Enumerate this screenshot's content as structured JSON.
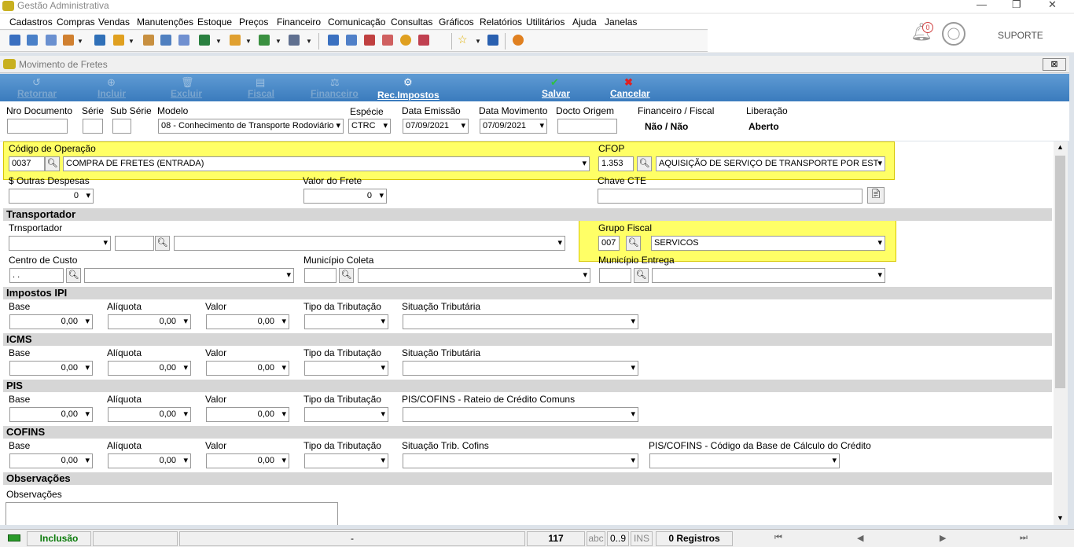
{
  "app": {
    "title": "Gestão Administrativa"
  },
  "menu": [
    "Cadastros",
    "Compras",
    "Vendas",
    "Manutenções",
    "Estoque",
    "Preços",
    "Financeiro",
    "Comunicação",
    "Consultas",
    "Gráficos",
    "Relatórios",
    "Utilitários",
    "Ajuda",
    "Janelas"
  ],
  "topright": {
    "notif_count": "0",
    "user": "SUPORTE"
  },
  "form": {
    "title": "Movimento de Fretes",
    "close": "⊠"
  },
  "actions": {
    "retornar": "Retornar",
    "incluir": "Incluir",
    "excluir": "Excluir",
    "fiscal": "Fiscal",
    "financeiro": "Financeiro",
    "rec_impostos": "Rec.Impostos",
    "salvar": "Salvar",
    "cancelar": "Cancelar"
  },
  "header": {
    "nro_documento": "Nro Documento",
    "serie": "Série",
    "sub_serie": "Sub Série",
    "modelo": "Modelo",
    "modelo_value": "08 - Conhecimento de Transporte Rodoviário",
    "especie": "Espécie",
    "especie_value": "CTRC",
    "data_emissao": "Data Emissão",
    "data_emissao_value": "07/09/2021",
    "data_movimento": "Data Movimento",
    "data_movimento_value": "07/09/2021",
    "docto_origem": "Docto Origem",
    "fin_fiscal": "Financeiro / Fiscal",
    "fin_fiscal_value": "Não / Não",
    "liberacao": "Liberação",
    "liberacao_value": "Aberto"
  },
  "operacao": {
    "label": "Código de Operação",
    "code": "0037",
    "desc": "COMPRA DE FRETES (ENTRADA)"
  },
  "cfop": {
    "label": "CFOP",
    "code": "1.353",
    "desc": "AQUISIÇÃO DE SERVIÇO DE TRANSPORTE POR EST"
  },
  "outras": {
    "label": "$ Outras Despesas",
    "value": "0"
  },
  "valor_frete": {
    "label": "Valor do Frete",
    "value": "0"
  },
  "chave_cte": {
    "label": "Chave CTE"
  },
  "transportador": {
    "section": "Transportador",
    "label": "Trnsportador",
    "grupo_fiscal": "Grupo Fiscal",
    "grupo_code": "007",
    "grupo_desc": "SERVICOS",
    "centro_custo": "Centro de Custo",
    "centro_value": " .  .",
    "municipio_coleta": "Município Coleta",
    "municipio_entrega": "Município Entrega"
  },
  "ipi": {
    "section": "Impostos IPI",
    "base": "Base",
    "aliquota": "Alíquota",
    "valor": "Valor",
    "tipo": "Tipo da Tributação",
    "situacao": "Situação Tributária",
    "v": "0,00"
  },
  "icms": {
    "section": "ICMS",
    "base": "Base",
    "aliquota": "Alíquota",
    "valor": "Valor",
    "tipo": "Tipo da Tributação",
    "situacao": "Situação Tributária",
    "v": "0,00"
  },
  "pis": {
    "section": "PIS",
    "base": "Base",
    "aliquota": "Alíquota",
    "valor": "Valor",
    "tipo": "Tipo da Tributação",
    "rateio": "PIS/COFINS - Rateio de Crédito Comuns",
    "v": "0,00"
  },
  "cofins": {
    "section": "COFINS",
    "base": "Base",
    "aliquota": "Alíquota",
    "valor": "Valor",
    "tipo": "Tipo da Tributação",
    "situacao": "Situação Trib. Cofins",
    "codigo_base": "PIS/COFINS - Código da Base de Cálculo do Crédito",
    "v": "0,00"
  },
  "obs": {
    "section": "Observações",
    "label": "Observações"
  },
  "status": {
    "mode": "Inclusão",
    "dash": "-",
    "count": "117",
    "abc": "abc",
    "range": "0..9",
    "ins": "INS",
    "registros": "0 Registros"
  }
}
